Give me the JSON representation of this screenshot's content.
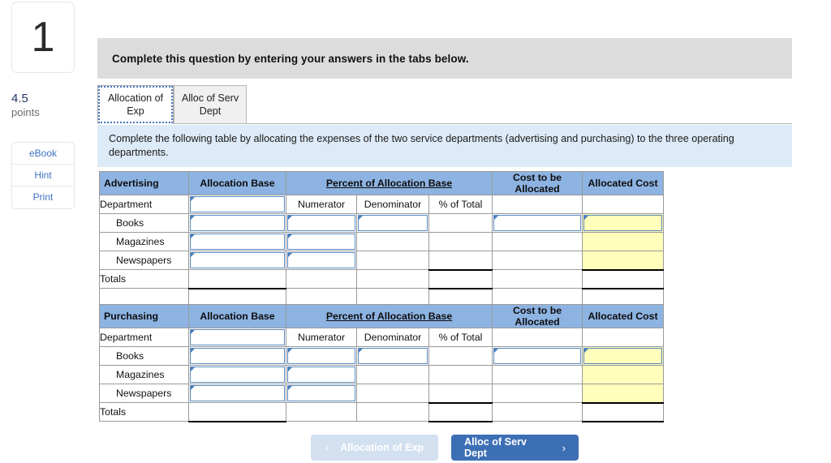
{
  "sidebar": {
    "question_number": "1",
    "points_value": "4.5",
    "points_label": "points",
    "tools": [
      {
        "label": "eBook"
      },
      {
        "label": "Hint"
      },
      {
        "label": "Print"
      }
    ]
  },
  "header": {
    "banner_text": "Complete this question by entering your answers in the tabs below."
  },
  "tabs": [
    {
      "label": "Allocation of Exp",
      "active": true
    },
    {
      "label": "Alloc of Serv Dept",
      "active": false
    }
  ],
  "instruction": {
    "text": "Complete the following table by allocating the expenses of the two service departments (advertising and purchasing) to the three operating departments."
  },
  "tables": [
    {
      "title": "Advertising",
      "headers": {
        "col1": "Advertising",
        "col2": "Allocation Base",
        "col3_group": "Percent of Allocation Base",
        "col6": "Cost to be Allocated",
        "col7": "Allocated Cost"
      },
      "subheaders": {
        "department": "Department",
        "numerator": "Numerator",
        "denominator": "Denominator",
        "percent_of_total": "% of Total"
      },
      "rows": [
        {
          "label": "Books"
        },
        {
          "label": "Magazines"
        },
        {
          "label": "Newspapers"
        }
      ],
      "totals_label": "Totals"
    },
    {
      "title": "Purchasing",
      "headers": {
        "col1": "Purchasing",
        "col2": "Allocation Base",
        "col3_group": "Percent of Allocation Base",
        "col6": "Cost to be Allocated",
        "col7": "Allocated Cost"
      },
      "subheaders": {
        "department": "Department",
        "numerator": "Numerator",
        "denominator": "Denominator",
        "percent_of_total": "% of Total"
      },
      "rows": [
        {
          "label": "Books"
        },
        {
          "label": "Magazines"
        },
        {
          "label": "Newspapers"
        }
      ],
      "totals_label": "Totals"
    }
  ],
  "navigation": {
    "prev_label": "Allocation of Exp",
    "next_label": "Alloc of Serv Dept",
    "prev_chevron": "‹",
    "next_chevron": "›",
    "prev_disabled": true
  },
  "colors": {
    "table_header_blue": "#8db3e2",
    "input_border_blue": "#5b8ac2",
    "highlight_yellow": "#ffffbb",
    "instruction_blue": "#ddeaf7",
    "banner_gray": "#dcdcdc",
    "nav_active_blue": "#3d6fb4",
    "nav_disabled_blue": "#d2e0f0",
    "link_blue": "#3f72c4",
    "points_navy": "#1f3864"
  }
}
